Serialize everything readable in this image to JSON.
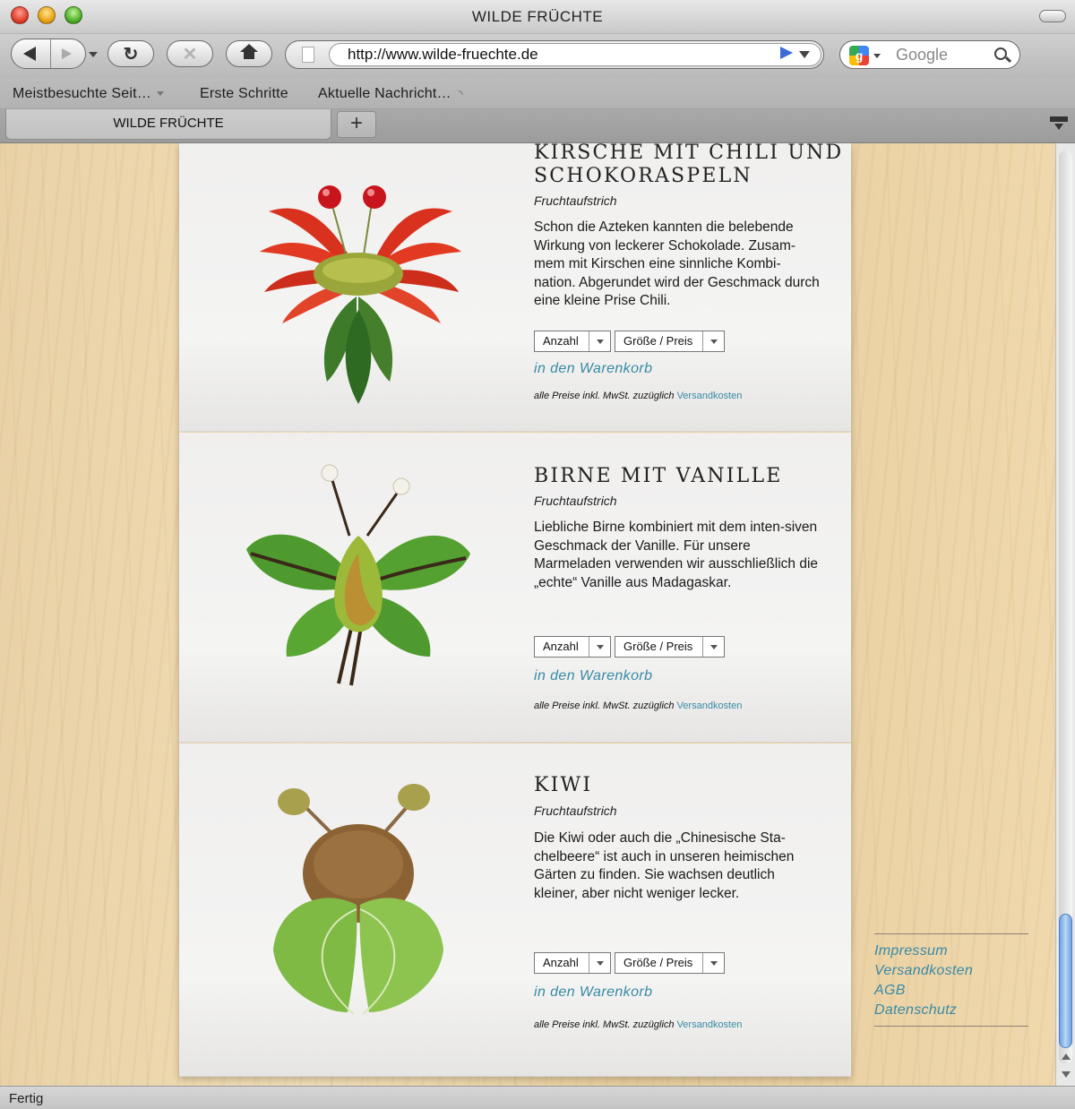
{
  "window": {
    "title": "WILDE FRÜCHTE"
  },
  "toolbar": {
    "url": "http://www.wilde-fruechte.de",
    "search_placeholder": "Google",
    "search_engine_letter": "g"
  },
  "bookmarks": [
    {
      "label": "Meistbesuchte Seit…"
    },
    {
      "label": "Erste Schritte"
    },
    {
      "label": "Aktuelle Nachricht…"
    }
  ],
  "tabs": {
    "active": "WILDE FRÜCHTE",
    "new_tab_label": "+"
  },
  "status": {
    "text": "Fertig"
  },
  "scroll": {
    "position_fraction": 0.97
  },
  "products": [
    {
      "title": "KIRSCHE MIT CHILI UND SCHOKORASPELN",
      "title_line1": "KIRSCHE MIT CHILI UND",
      "title_line2": "SCHOKORASPELN",
      "subtitle": "Fruchtaufstrich",
      "description": "Schon die Azteken kannten die belebende Wirkung von leckerer Schokolade. Zusam-mem mit Kirschen eine sinnliche Kombi-nation. Abgerundet wird der Geschmack durch eine kleine Prise Chili.",
      "quantity_label": "Anzahl",
      "size_label": "Größe / Preis",
      "cart_label": "in den Warenkorb",
      "price_note": "alle Preise inkl. MwSt. zuzüglich",
      "shipping_link": "Versandkosten"
    },
    {
      "title": "BIRNE MIT VANILLE",
      "subtitle": "Fruchtaufstrich",
      "description": "Liebliche Birne kombiniert mit dem inten-siven Geschmack der Vanille. Für unsere Marmeladen verwenden wir ausschließlich die „echte“ Vanille aus Madagaskar.",
      "quantity_label": "Anzahl",
      "size_label": "Größe / Preis",
      "cart_label": "in den Warenkorb",
      "price_note": "alle Preise inkl. MwSt. zuzüglich",
      "shipping_link": "Versandkosten"
    },
    {
      "title": "KIWI",
      "subtitle": "Fruchtaufstrich",
      "description": "Die Kiwi oder auch die „Chinesische Sta-chelbeere“ ist auch in unseren heimischen Gärten zu finden. Sie wachsen deutlich kleiner, aber nicht weniger lecker.",
      "quantity_label": "Anzahl",
      "size_label": "Größe / Preis",
      "cart_label": "in den Warenkorb",
      "price_note": "alle Preise inkl. MwSt. zuzüglich",
      "shipping_link": "Versandkosten"
    }
  ],
  "footer": {
    "links": [
      "Impressum",
      "Versandkosten",
      "AGB",
      "Datenschutz"
    ]
  },
  "colors": {
    "link": "#3a8aa6",
    "wood": "#ecd5ab",
    "card": "#f2f1f0"
  }
}
